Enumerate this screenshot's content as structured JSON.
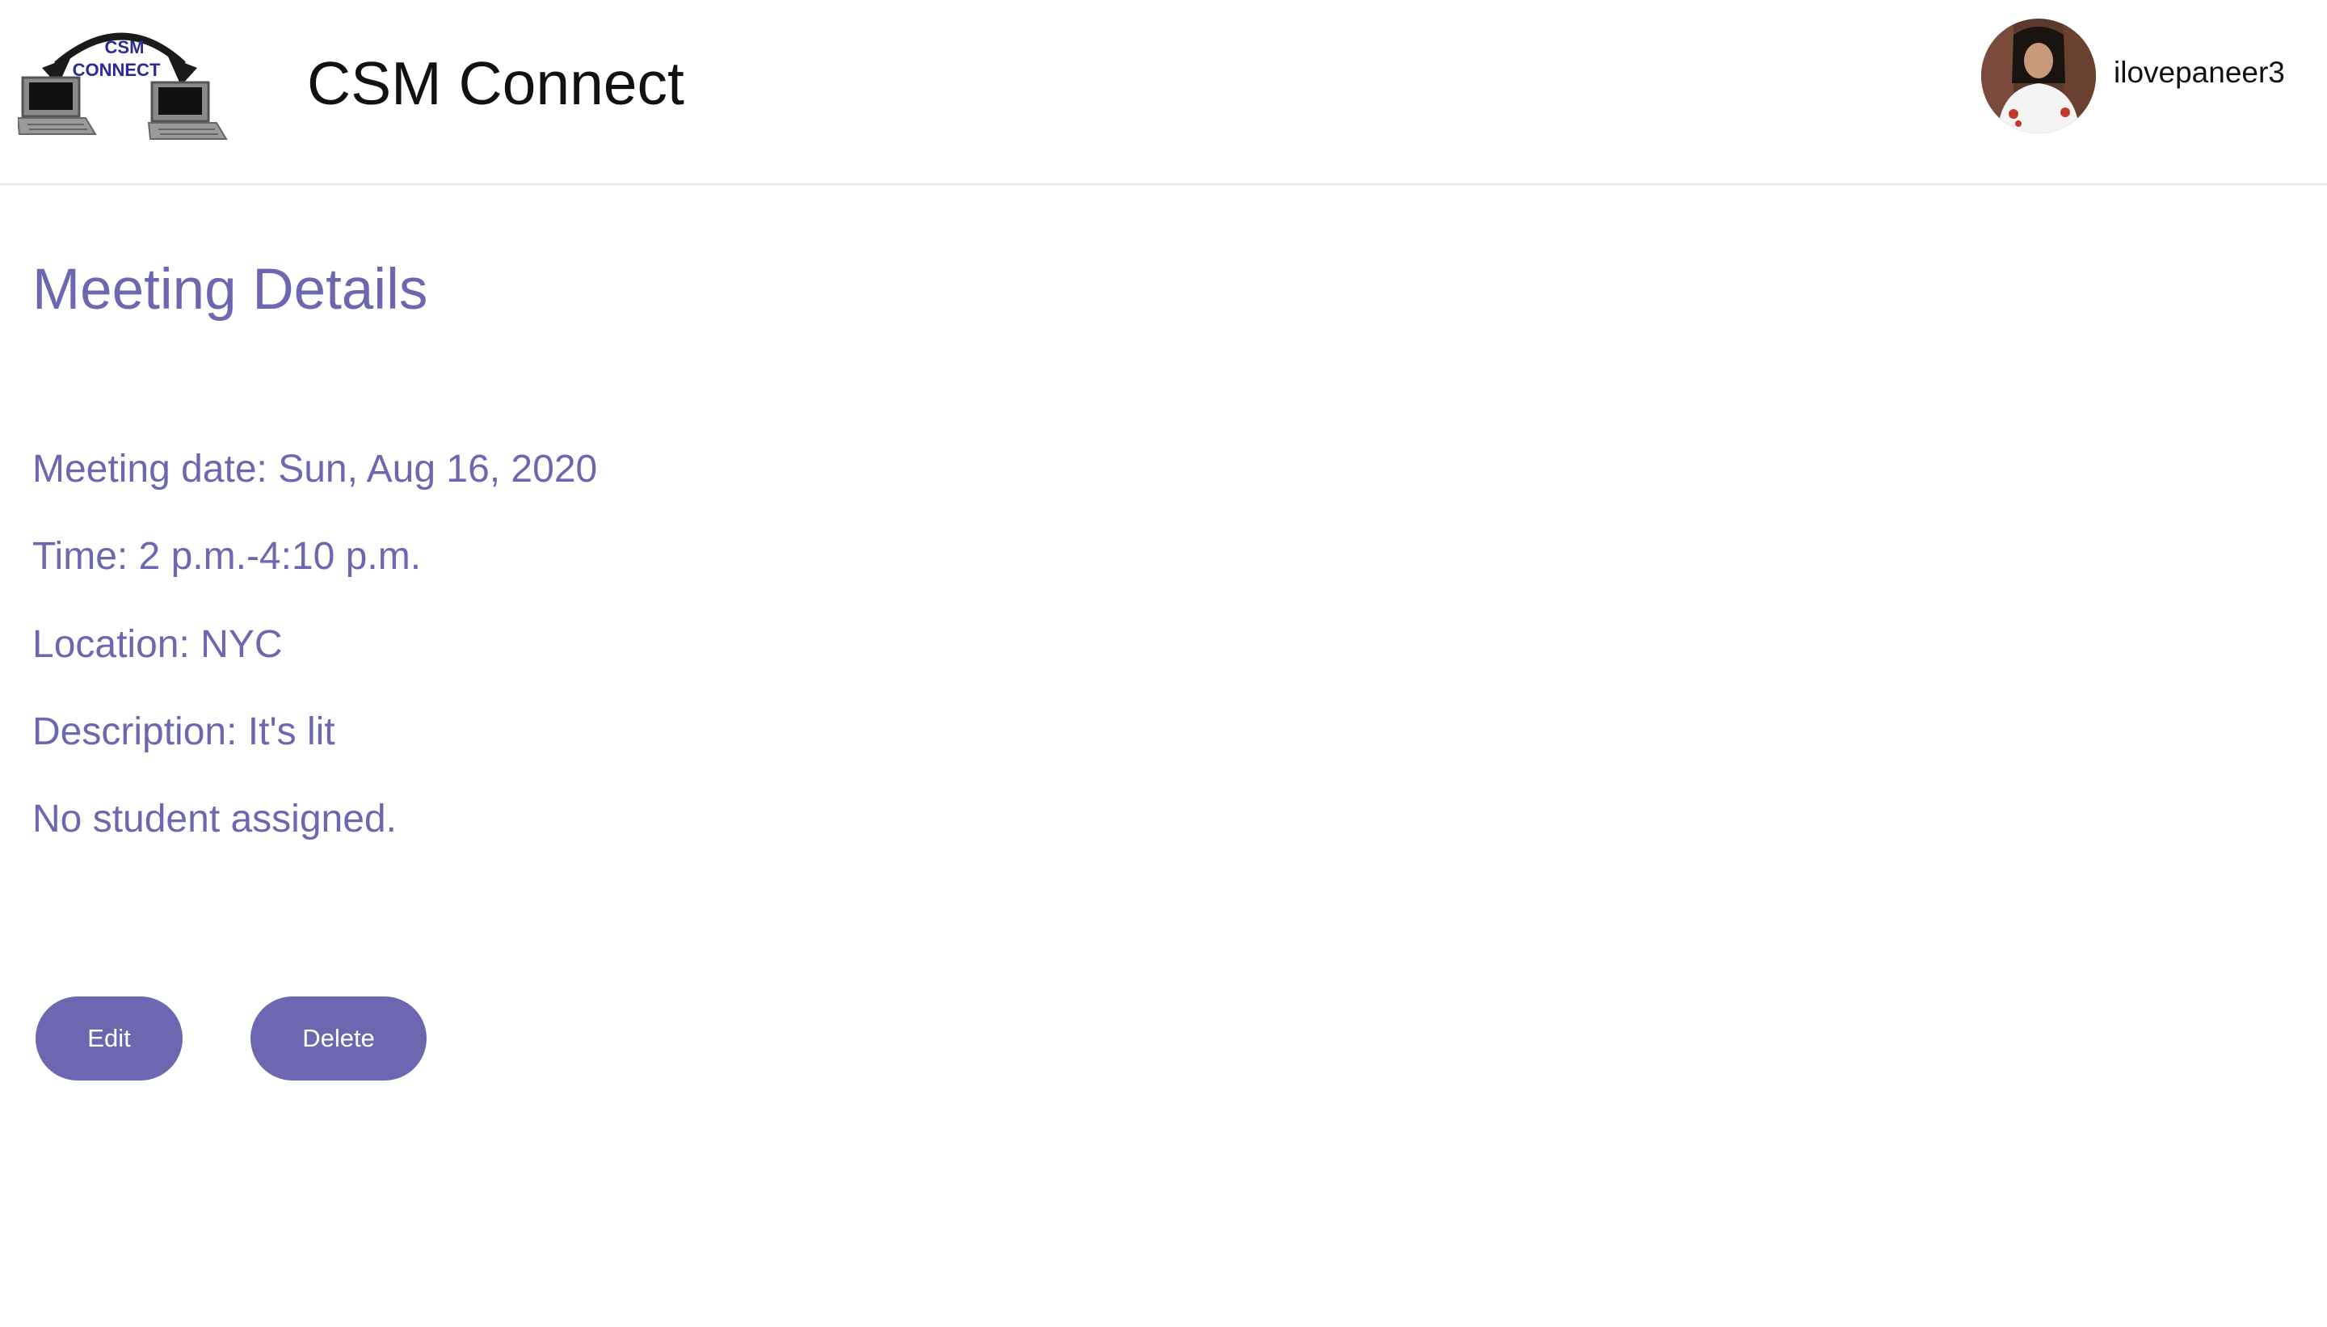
{
  "header": {
    "logo": {
      "line1": "CSM",
      "line2": "CONNECT"
    },
    "app_title": "CSM Connect",
    "user": {
      "username": "ilovepaneer3"
    }
  },
  "main": {
    "page_title": "Meeting Details",
    "details": {
      "meeting_date": "Meeting date: Sun, Aug 16, 2020",
      "time": "Time: 2 p.m.-4:10 p.m.",
      "location": "Location: NYC",
      "description": "Description: It's lit",
      "student_status": "No student assigned."
    },
    "actions": {
      "edit_label": "Edit",
      "delete_label": "Delete"
    }
  },
  "colors": {
    "accent": "#6d67b2",
    "header_border": "#e6e6e6",
    "title_text": "#111111"
  }
}
